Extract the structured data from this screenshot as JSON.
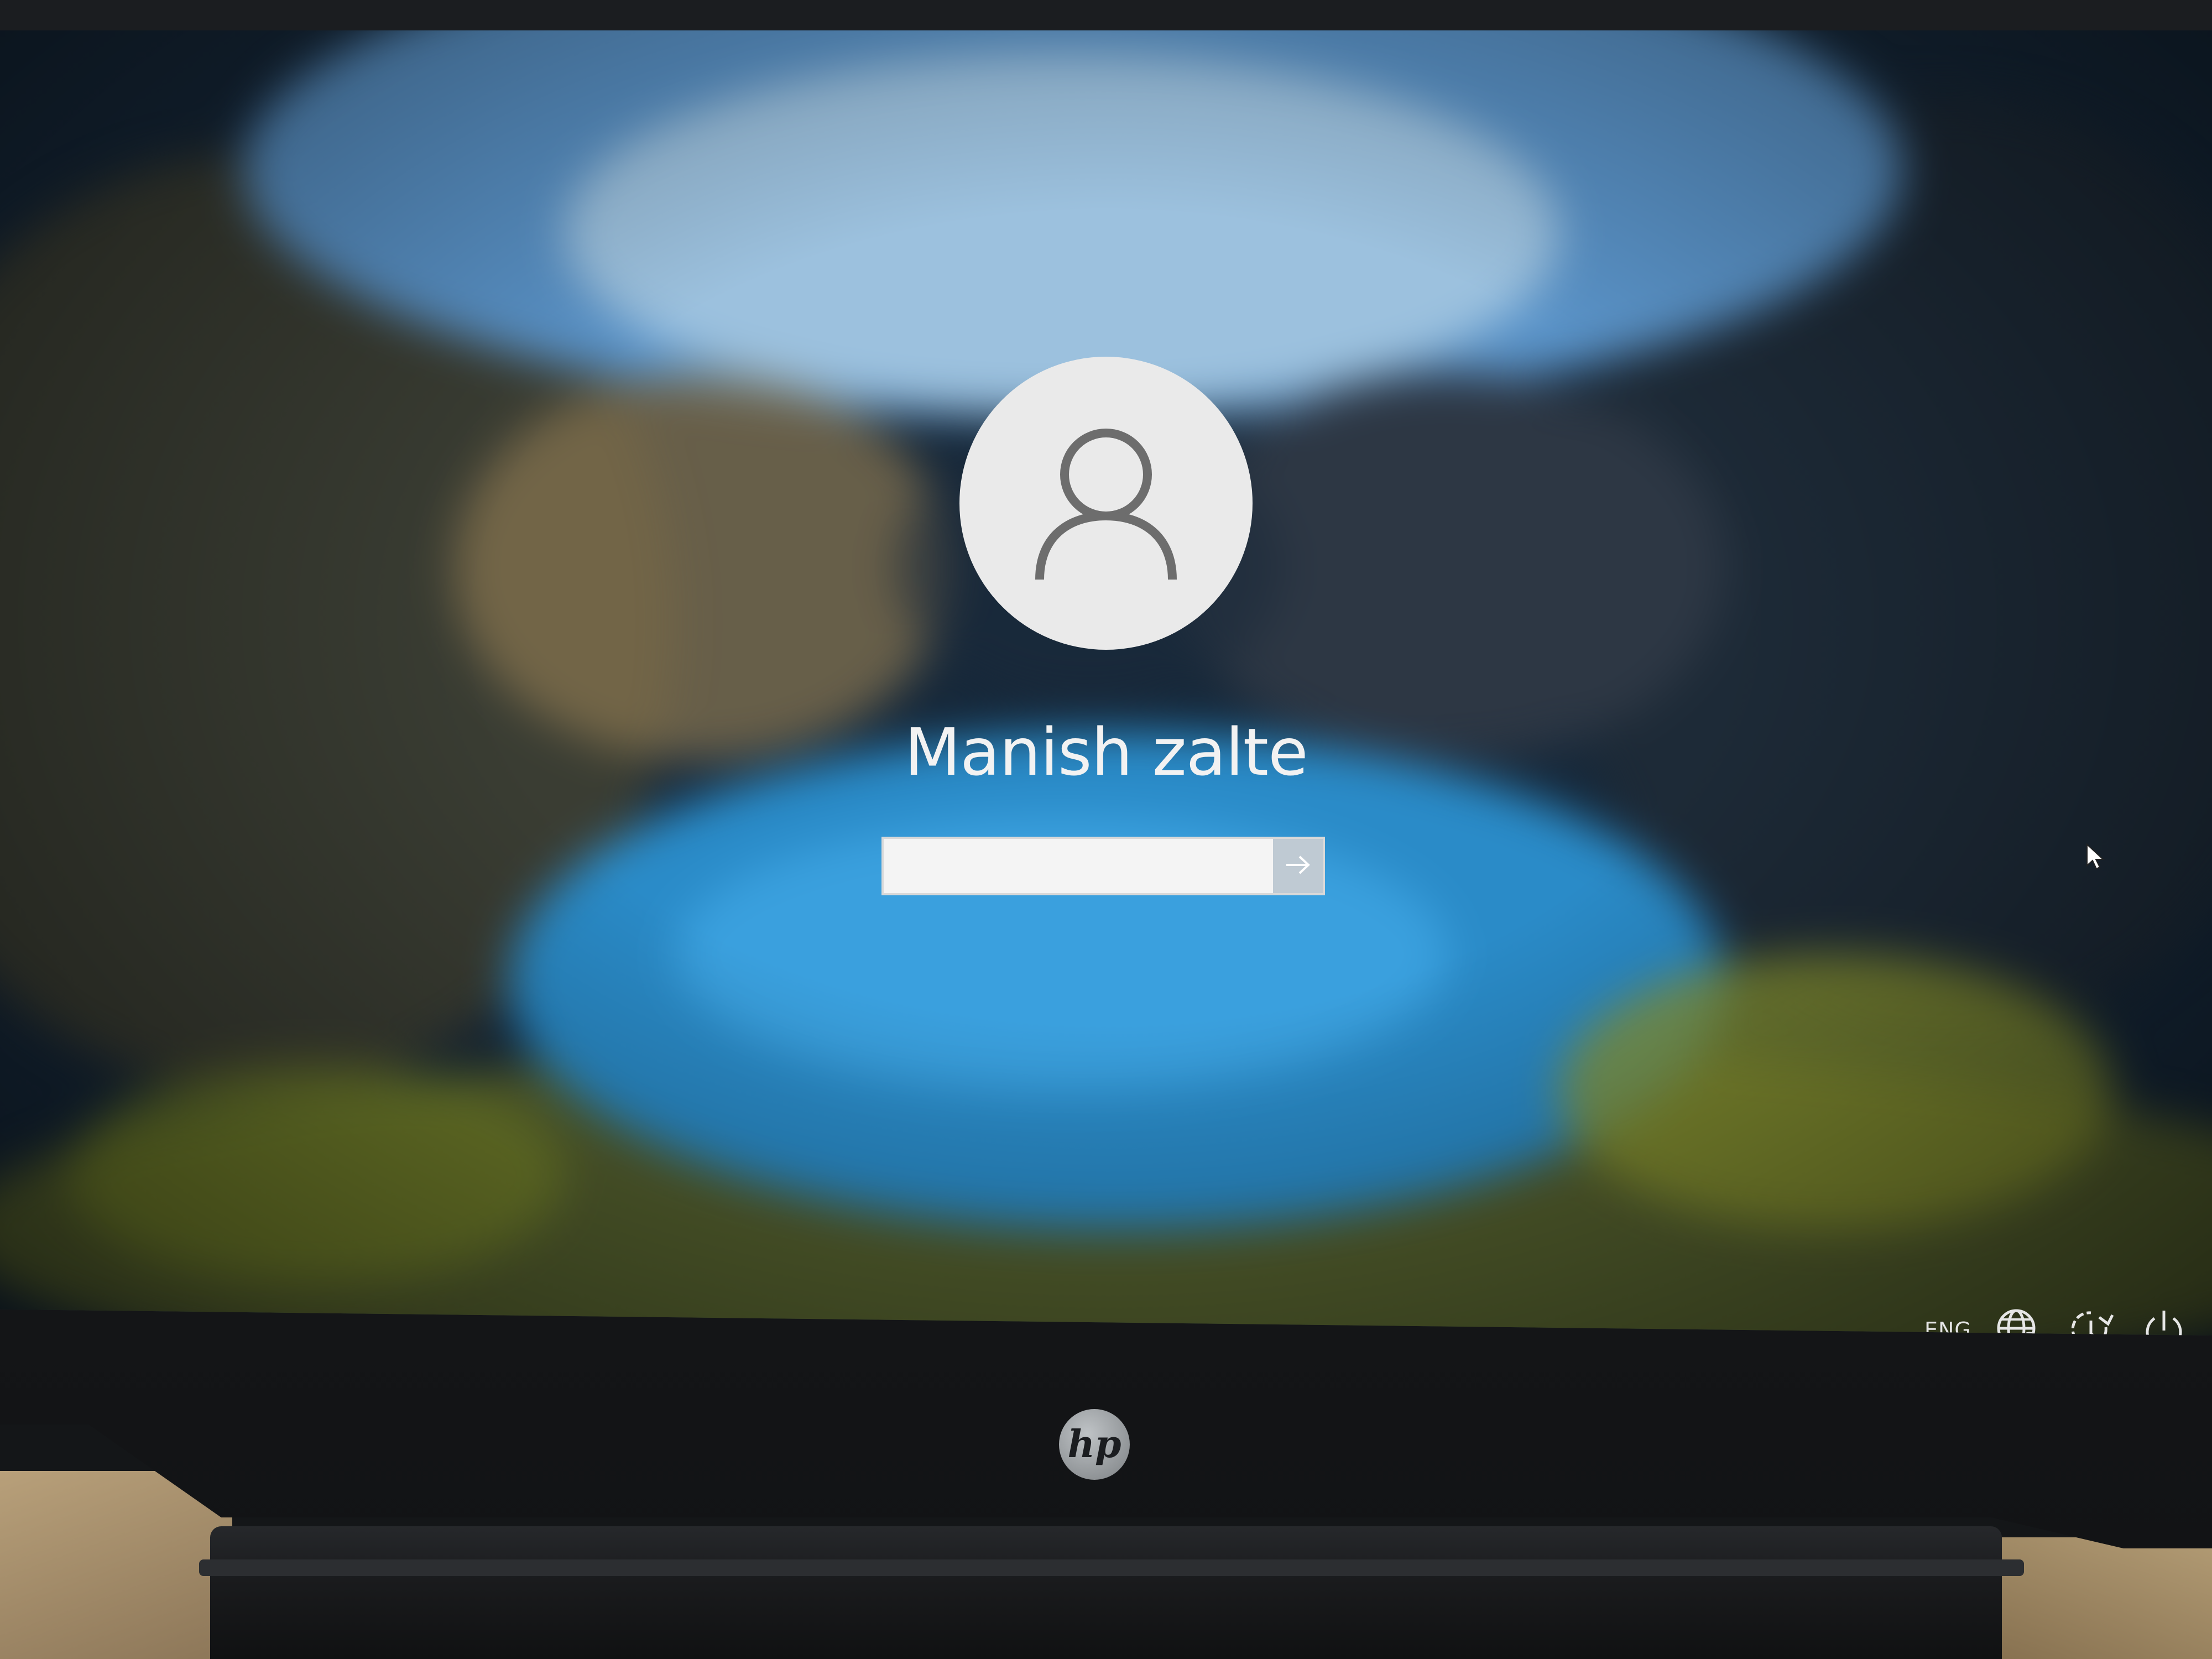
{
  "login": {
    "username": "Manish zalte",
    "password_value": "",
    "avatar_icon": "user-icon",
    "submit_icon": "arrow-right-icon"
  },
  "tray": {
    "language": "ENG",
    "icons": [
      "network-icon",
      "accessibility-icon",
      "power-icon"
    ]
  },
  "hardware": {
    "logo_text": "hp"
  },
  "colors": {
    "accent": "#bfcad3",
    "text": "#f2f2f2"
  }
}
